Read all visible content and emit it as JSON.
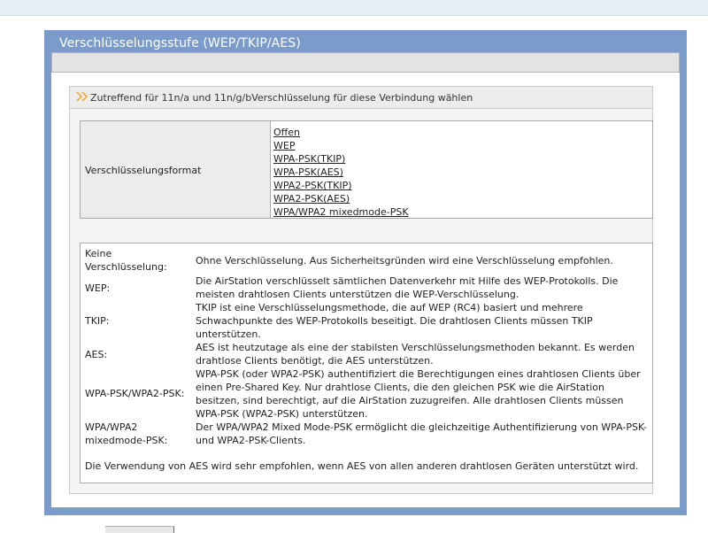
{
  "header": {
    "title": "Verschlüsselungsstufe (WEP/TKIP/AES)"
  },
  "section": {
    "heading": "Zutreffend für 11n/a und 11n/g/bVerschlüsselung für diese Verbindung wählen",
    "format_label": "Verschlüsselungsformat",
    "options": [
      "Offen",
      "WEP",
      "WPA-PSK(TKIP)",
      "WPA-PSK(AES)",
      "WPA2-PSK(TKIP)",
      "WPA2-PSK(AES)",
      "WPA/WPA2 mixedmode-PSK"
    ]
  },
  "descriptions": [
    {
      "term": [
        "Keine",
        "Verschlüsselung:"
      ],
      "text": [
        "Ohne Verschlüsselung. Aus Sicherheitsgründen wird eine Verschlüsselung empfohlen."
      ]
    },
    {
      "term": [
        "WEP:"
      ],
      "text": [
        "Die AirStation verschlüsselt sämtlichen Datenverkehr mit Hilfe des WEP-Protokolls. Die",
        "meisten drahtlosen Clients unterstützen die WEP-Verschlüsselung."
      ]
    },
    {
      "term": [
        "TKIP:"
      ],
      "text": [
        "TKIP ist eine Verschlüsselungsmethode, die auf WEP (RC4) basiert und mehrere",
        "Schwachpunkte des WEP-Protokolls beseitigt. Die drahtlosen Clients müssen TKIP",
        "unterstützen."
      ]
    },
    {
      "term": [
        "AES:"
      ],
      "text": [
        "AES ist heutzutage als eine der stabilsten Verschlüsselungsmethoden bekannt. Es werden",
        "drahtlose Clients benötigt, die AES unterstützen."
      ]
    },
    {
      "term": [
        "WPA-PSK/WPA2-PSK:"
      ],
      "text": [
        "WPA-PSK (oder WPA2-PSK) authentifiziert die Berechtigungen eines drahtlosen Clients über",
        "einen Pre-Shared Key. Nur drahtlose Clients, die den gleichen PSK wie die AirStation",
        "besitzen, sind berechtigt, auf die AirStation zuzugreifen. Alle drahtlosen Clients müssen",
        "WPA-PSK (WPA2-PSK) unterstützen."
      ]
    },
    {
      "term": [
        "WPA/WPA2",
        "mixedmode-PSK:"
      ],
      "text": [
        "Der WPA/WPA2 Mixed Mode-PSK ermöglicht die gleichzeitige Authentifizierung von WPA-PSK-",
        "und WPA2-PSK-Clients."
      ]
    }
  ],
  "note": "Die Verwendung von AES wird sehr empfohlen, wenn AES von allen anderen drahtlosen Geräten unterstützt wird.",
  "colors": {
    "frame": "#7b9cca",
    "header_text": "#ffffff",
    "accent_arrow": "#f0a020"
  },
  "icons": {
    "section_marker": "double-chevron-right-icon"
  }
}
